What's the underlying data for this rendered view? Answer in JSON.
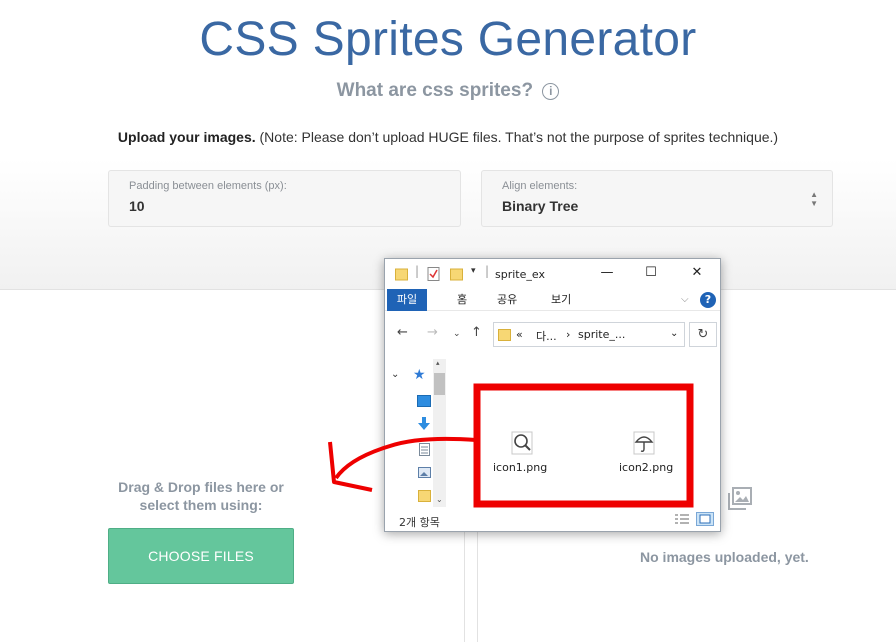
{
  "page": {
    "title": "CSS Sprites Generator",
    "subtitle": "What are css sprites?",
    "info_icon_glyph": "i",
    "upload_bold": "Upload your images.",
    "upload_note": " (Note: Please don’t upload HUGE files. That’s not the purpose of sprites technique.)"
  },
  "padding_field": {
    "label": "Padding between elements (px):",
    "value": "10"
  },
  "align_field": {
    "label": "Align elements:",
    "value": "Binary Tree",
    "icon": "select-arrows-icon"
  },
  "dropzone": {
    "line1": "Drag & Drop files here or",
    "line2": "select them using:",
    "button_label": "CHOOSE FILES"
  },
  "preview": {
    "empty_text": "No images uploaded, yet.",
    "icon": "image-placeholder-icon"
  },
  "explorer": {
    "title": "sprite_ex",
    "tabs": [
      "파일",
      "홈",
      "공유",
      "보기"
    ],
    "address": {
      "chevrons": "«",
      "part1": "다...",
      "sep": "›",
      "part2": "sprite_..."
    },
    "files": [
      {
        "name": "icon1.png",
        "icon": "magnifier-file-icon"
      },
      {
        "name": "icon2.png",
        "icon": "umbrella-file-icon"
      }
    ],
    "status": "2개 항목",
    "help_glyph": "?"
  },
  "annotation": {
    "color": "#ee0000"
  },
  "colors": {
    "title": "#3a68a3",
    "accent_green": "#64c69c",
    "muted": "#8c96a1",
    "ribbon_blue": "#1f63b6"
  }
}
